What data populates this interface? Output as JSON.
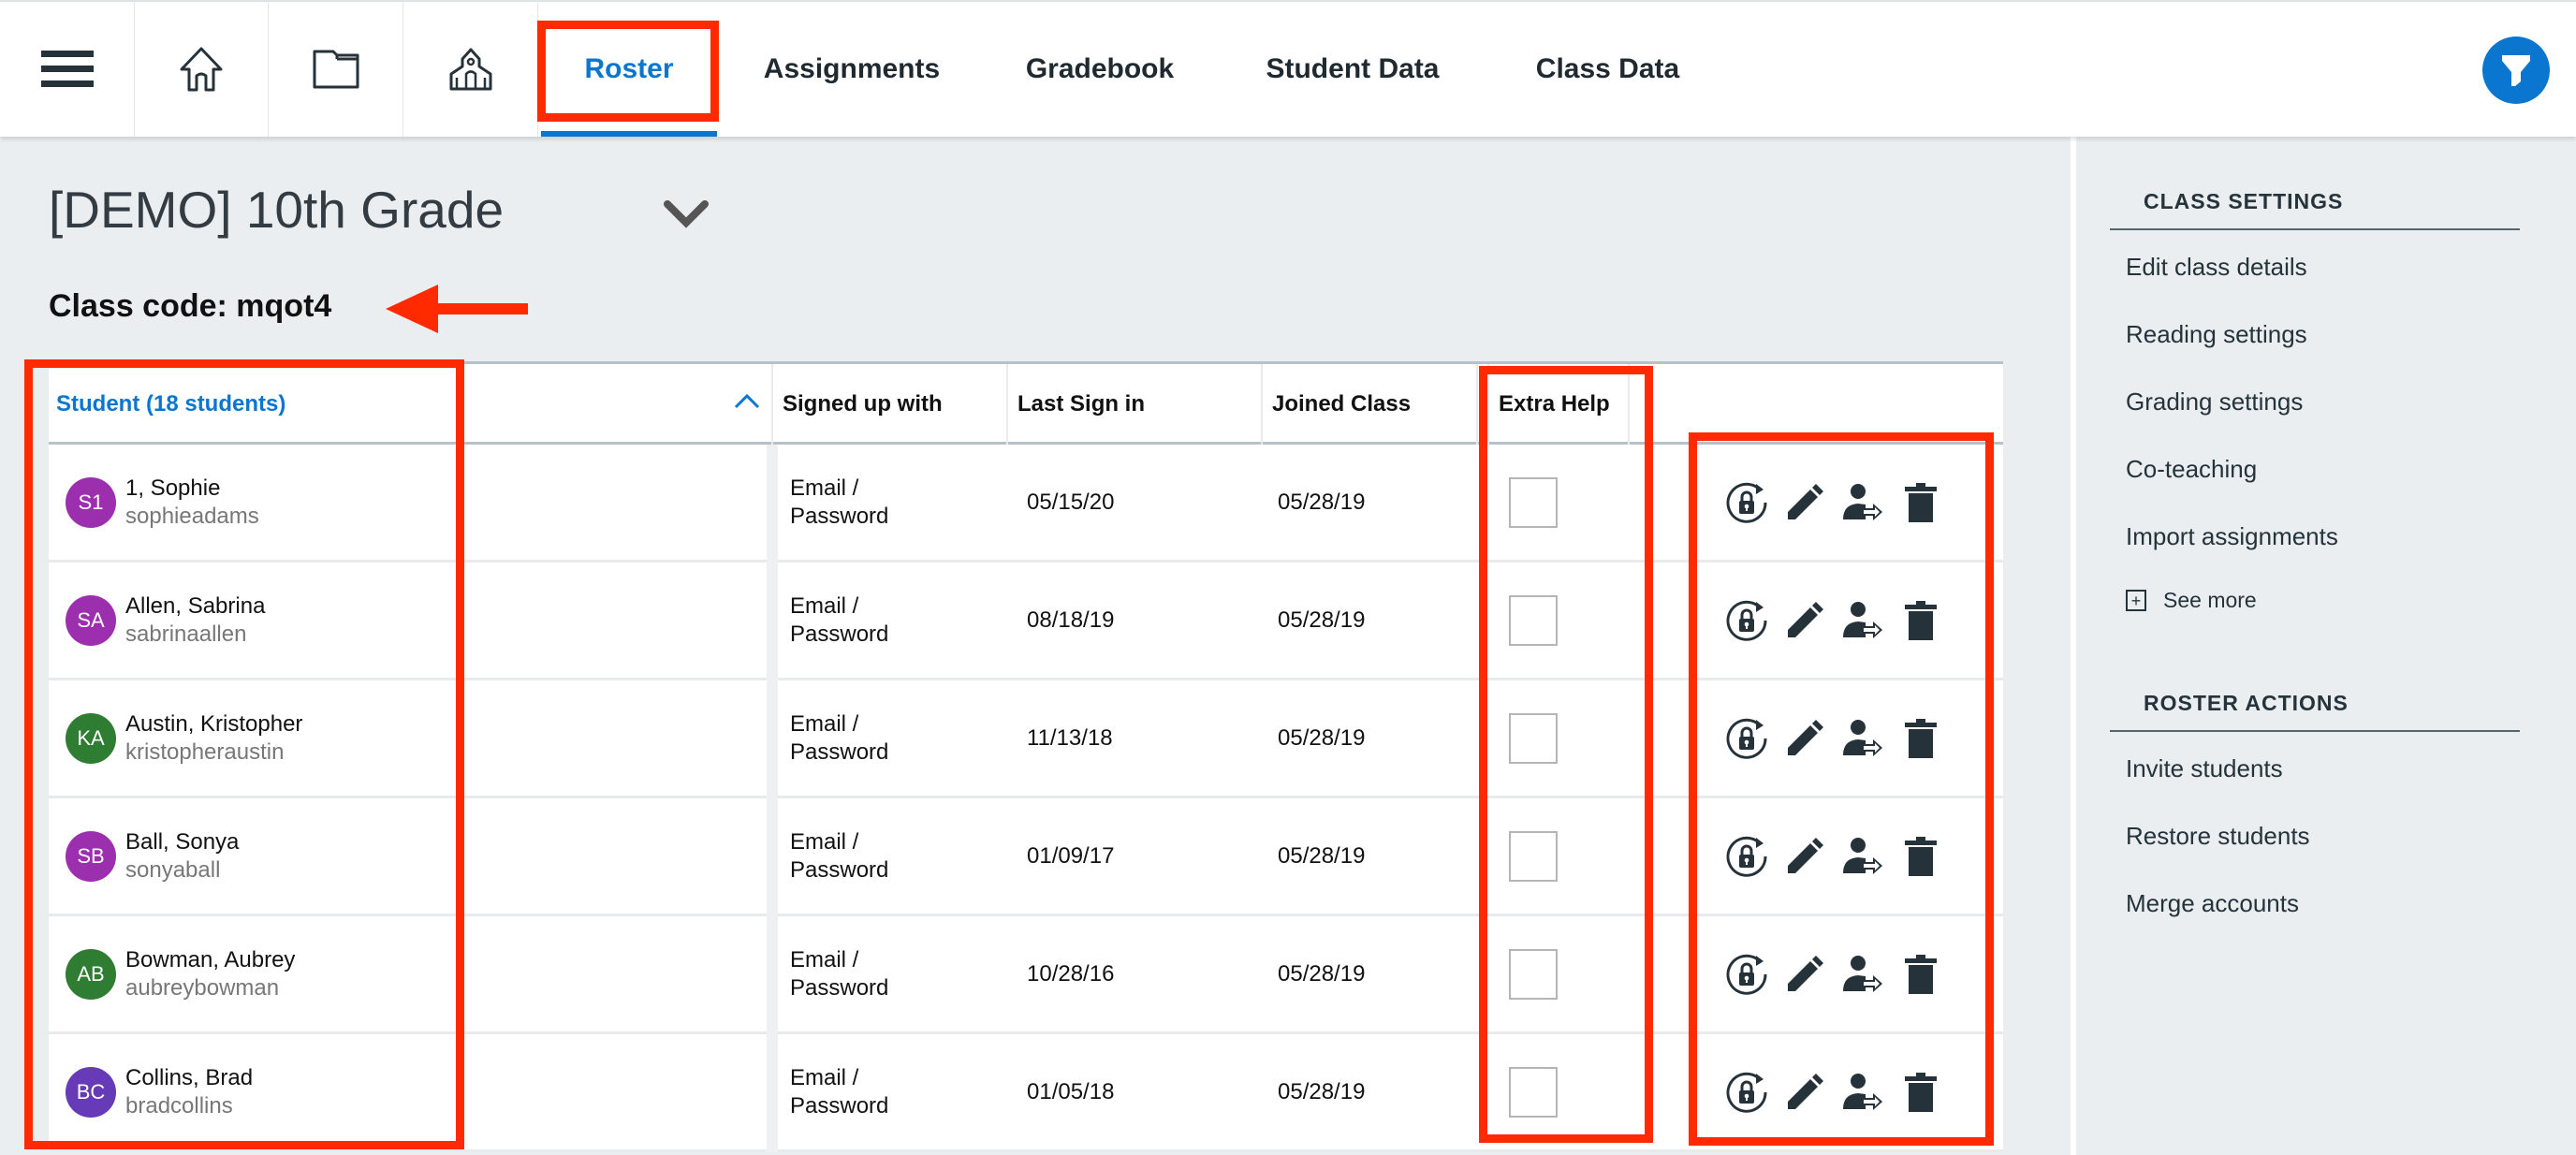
{
  "nav": {
    "icons": [
      "menu-icon",
      "home-icon",
      "folder-icon",
      "school-icon"
    ],
    "tabs": [
      {
        "label": "Roster",
        "active": true
      },
      {
        "label": "Assignments",
        "active": false
      },
      {
        "label": "Gradebook",
        "active": false
      },
      {
        "label": "Student Data",
        "active": false
      },
      {
        "label": "Class Data",
        "active": false
      }
    ],
    "filter_icon": "filter-icon"
  },
  "class": {
    "title": "[DEMO] 10th Grade",
    "code_label": "Class code: mqot4"
  },
  "table": {
    "headers": {
      "student": "Student (18 students)",
      "signed_up_with": "Signed up with",
      "last_sign_in": "Last Sign in",
      "joined_class": "Joined Class",
      "extra_help": "Extra Help"
    },
    "rows": [
      {
        "initials": "S1",
        "avatar_color": "#9c2fae",
        "name": "1, Sophie",
        "username": "sophieadams",
        "signup_line1": "Email /",
        "signup_line2": "Password",
        "last_sign_in": "05/15/20",
        "joined": "05/28/19",
        "extra_help": false
      },
      {
        "initials": "SA",
        "avatar_color": "#9c2fae",
        "name": "Allen, Sabrina",
        "username": "sabrinaallen",
        "signup_line1": "Email /",
        "signup_line2": "Password",
        "last_sign_in": "08/18/19",
        "joined": "05/28/19",
        "extra_help": false
      },
      {
        "initials": "KA",
        "avatar_color": "#2e7d32",
        "name": "Austin, Kristopher",
        "username": "kristopheraustin",
        "signup_line1": "Email /",
        "signup_line2": "Password",
        "last_sign_in": "11/13/18",
        "joined": "05/28/19",
        "extra_help": false
      },
      {
        "initials": "SB",
        "avatar_color": "#9c2fae",
        "name": "Ball, Sonya",
        "username": "sonyaball",
        "signup_line1": "Email /",
        "signup_line2": "Password",
        "last_sign_in": "01/09/17",
        "joined": "05/28/19",
        "extra_help": false
      },
      {
        "initials": "AB",
        "avatar_color": "#2e7d32",
        "name": "Bowman, Aubrey",
        "username": "aubreybowman",
        "signup_line1": "Email /",
        "signup_line2": "Password",
        "last_sign_in": "10/28/16",
        "joined": "05/28/19",
        "extra_help": false
      },
      {
        "initials": "BC",
        "avatar_color": "#673ab7",
        "name": "Collins, Brad",
        "username": "bradcollins",
        "signup_line1": "Email /",
        "signup_line2": "Password",
        "last_sign_in": "01/05/18",
        "joined": "05/28/19",
        "extra_help": false
      }
    ],
    "row_actions": [
      "reset-password-icon",
      "edit-icon",
      "move-student-icon",
      "delete-icon"
    ]
  },
  "sidebar": {
    "class_settings": {
      "heading": "CLASS SETTINGS",
      "links": [
        "Edit class details",
        "Reading settings",
        "Grading settings",
        "Co-teaching",
        "Import assignments"
      ],
      "see_more": "See more"
    },
    "roster_actions": {
      "heading": "ROSTER ACTIONS",
      "links": [
        "Invite students",
        "Restore students",
        "Merge accounts"
      ]
    }
  },
  "colors": {
    "accent": "#0a76cf",
    "annotation": "#ff2a00",
    "background": "#ebeef0"
  }
}
